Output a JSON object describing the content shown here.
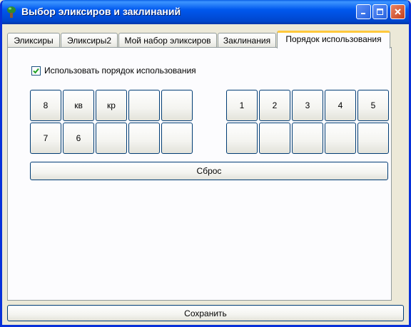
{
  "window": {
    "title": "Выбор эликсиров и заклинаний",
    "accent": "#0054e3"
  },
  "tabs": [
    {
      "label": "Эликсиры"
    },
    {
      "label": "Эликсиры2"
    },
    {
      "label": "Мой набор эликсиров"
    },
    {
      "label": "Заклинания"
    },
    {
      "label": "Порядок использования",
      "active": true
    }
  ],
  "panel": {
    "use_order_checkbox": {
      "label": "Использовать порядок использования",
      "checked": true
    },
    "left_grid": [
      "8",
      "кв",
      "кр",
      "",
      "",
      "7",
      "6",
      "",
      "",
      ""
    ],
    "right_grid": [
      "1",
      "2",
      "3",
      "4",
      "5",
      "",
      "",
      "",
      "",
      ""
    ],
    "reset_label": "Сброс"
  },
  "save_label": "Сохранить"
}
